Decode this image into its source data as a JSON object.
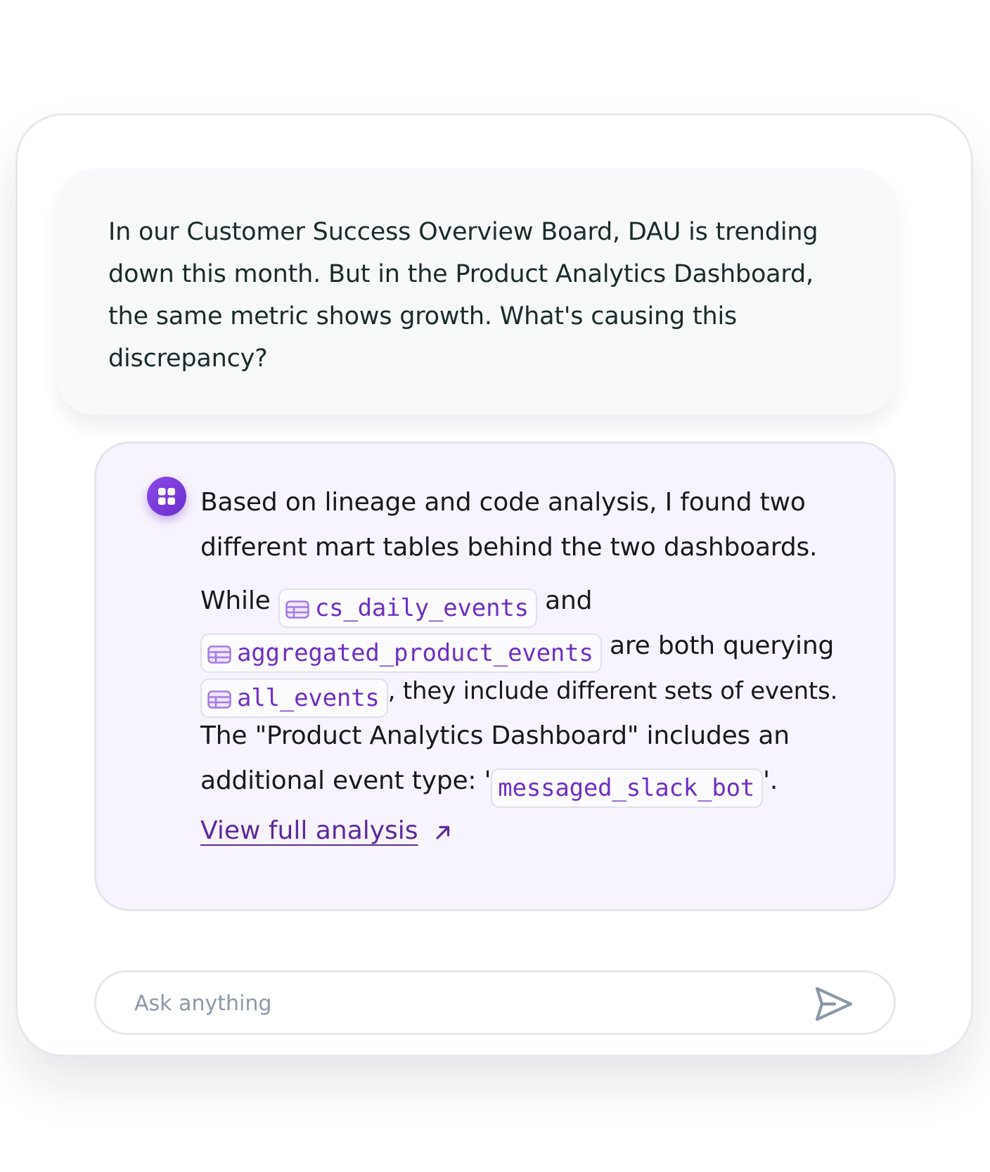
{
  "user_message": {
    "lines": [
      "In our Customer Success Overview Board, DAU is trending",
      "down this month. But in the Product Analytics Dashboard,",
      "the same metric shows growth. What's causing this",
      "discrepancy?"
    ]
  },
  "assistant": {
    "avatar_icon": "grid-logo-icon",
    "intro_lines": [
      "Based on lineage and code analysis, I found two",
      "different mart tables behind the two dashboards."
    ],
    "while": "While",
    "table1": "cs_daily_events",
    "and": "and",
    "table2": "aggregated_product_events",
    "both_querying": "are both querying",
    "table3": "all_events",
    "different_sets": ", they include different sets of events.",
    "dashboard_line": "The \"Product Analytics Dashboard\" includes an",
    "event_type_prefix": "additional event type: '",
    "event_name": "messaged_slack_bot",
    "event_type_suffix": "'.",
    "link_label": "View full analysis",
    "link_icon": "arrow-up-right-icon",
    "table_icon": "table-icon"
  },
  "composer": {
    "placeholder": "Ask anything",
    "send_icon": "send-icon"
  },
  "colors": {
    "accent": "#6f2fc4",
    "link": "#5c2a9d",
    "answer_bg": "#f8f4fd",
    "user_bg": "#f7f9fb"
  }
}
